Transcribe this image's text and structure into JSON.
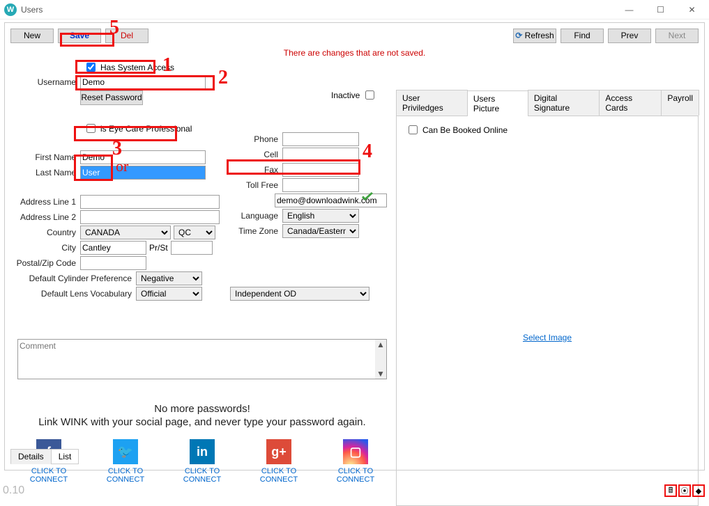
{
  "window": {
    "title": "Users",
    "version": "0.10"
  },
  "toolbar": {
    "new": "New",
    "save": "Save",
    "del": "Del",
    "refresh": "Refresh",
    "find": "Find",
    "prev": "Prev",
    "next": "Next"
  },
  "unsaved_msg": "There are changes that are not saved.",
  "has_system_access": {
    "label": "Has System Access",
    "checked": true
  },
  "inactive": {
    "label": "Inactive",
    "checked": false
  },
  "username": {
    "label": "Username",
    "value": "Demo"
  },
  "reset_password": "Reset Password",
  "eyecare": {
    "label": "is Eye Care Professional",
    "checked": false
  },
  "first_name": {
    "label": "First Name",
    "value": "Demo"
  },
  "last_name": {
    "label": "Last Name",
    "value": "User"
  },
  "address1": {
    "label": "Address Line 1",
    "value": ""
  },
  "address2": {
    "label": "Address Line 2",
    "value": ""
  },
  "country": {
    "label": "Country",
    "value": "CANADA",
    "prov": "QC"
  },
  "city": {
    "label": "City",
    "value": "Cantley",
    "prst_label": "Pr/St"
  },
  "postal": {
    "label": "Postal/Zip Code",
    "value": ""
  },
  "cylpref": {
    "label": "Default Cylinder Preference",
    "value": "Negative"
  },
  "lensvocab": {
    "label": "Default Lens Vocabulary",
    "value": "Official"
  },
  "independent": "Independent OD",
  "phone": {
    "label": "Phone",
    "value": ""
  },
  "cell": {
    "label": "Cell",
    "value": ""
  },
  "fax": {
    "label": "Fax",
    "value": ""
  },
  "tollfree": {
    "label": "Toll Free",
    "value": ""
  },
  "email": {
    "value": "demo@downloadwink.com"
  },
  "language": {
    "label": "Language",
    "value": "English"
  },
  "timezone": {
    "label": "Time Zone",
    "value": "Canada/Eastern"
  },
  "comment_placeholder": "Comment",
  "social": {
    "heading": "No more passwords!",
    "tag": "Link WINK with your social page, and never type your password again.",
    "connect": "CLICK TO CONNECT"
  },
  "right_tabs": [
    "User Priviledges",
    "Users Picture",
    "Digital Signature",
    "Access Cards",
    "Payroll"
  ],
  "right_tab_active": 1,
  "can_be_booked": {
    "label": "Can Be Booked Online",
    "checked": false
  },
  "select_image": "Select Image ",
  "bottom_tabs": [
    "Details",
    "List"
  ],
  "annotations": {
    "1": "1",
    "2": "2",
    "3": "3",
    "4": "4",
    "5": "5",
    "or": "or"
  }
}
